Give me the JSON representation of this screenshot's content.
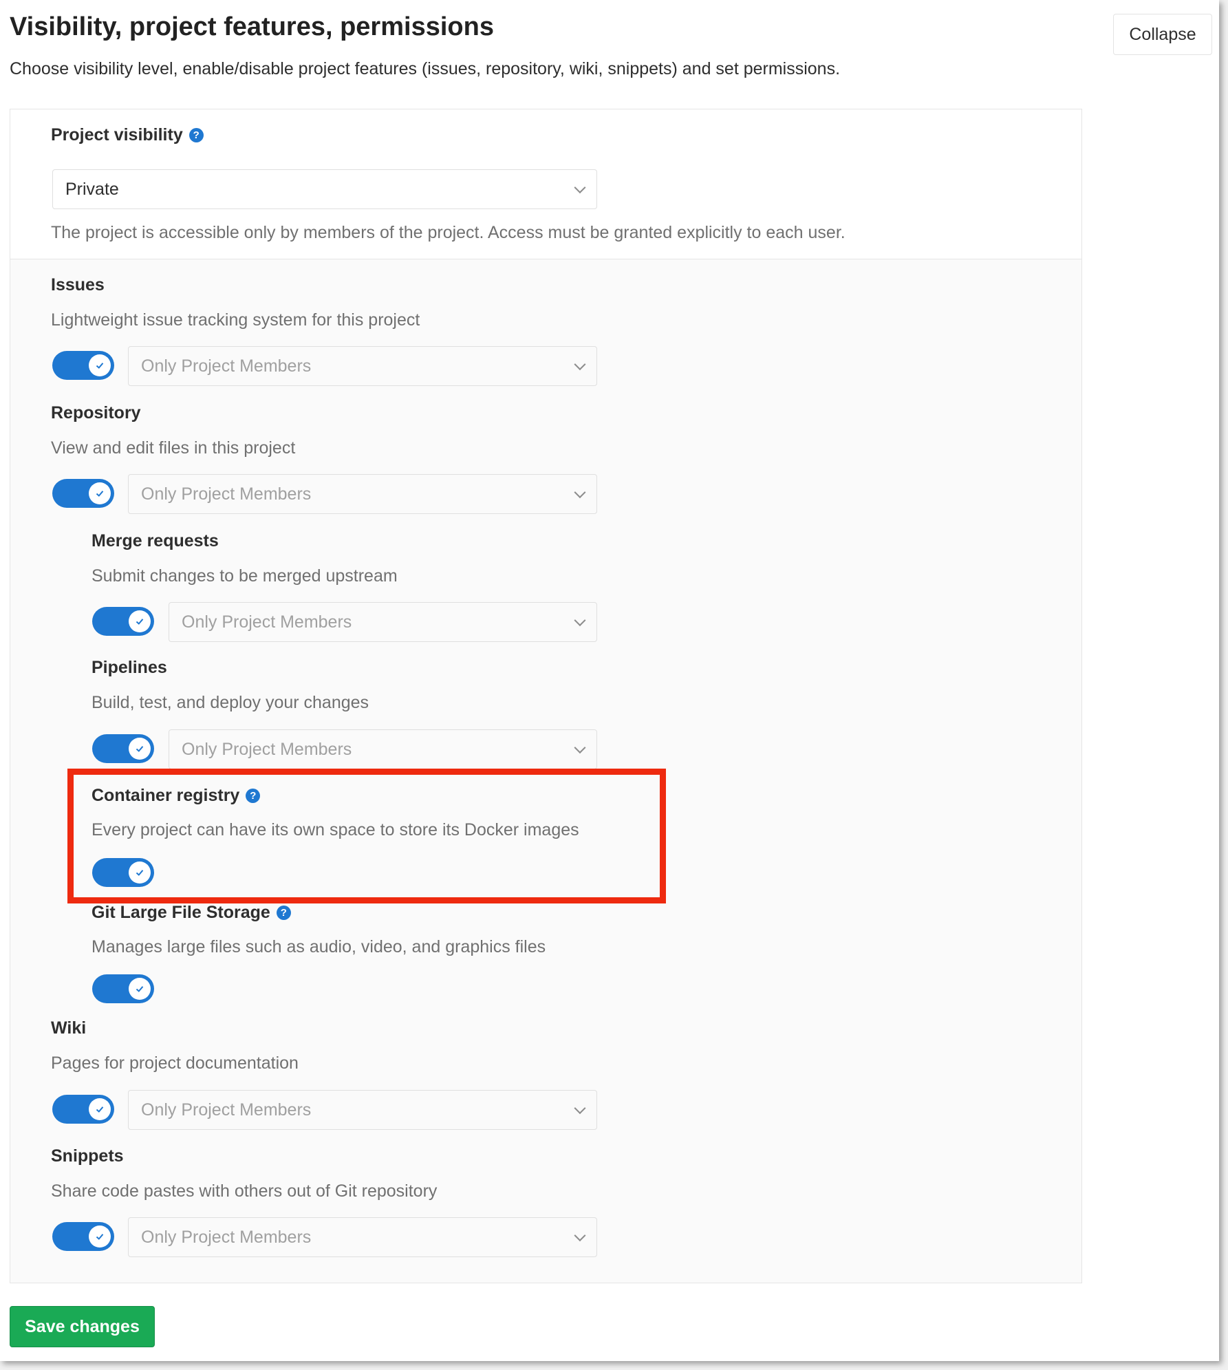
{
  "header": {
    "title": "Visibility, project features, permissions",
    "subtitle": "Choose visibility level, enable/disable project features (issues, repository, wiki, snippets) and set permissions.",
    "collapse_label": "Collapse"
  },
  "visibility": {
    "label": "Project visibility",
    "help_glyph": "?",
    "selected": "Private",
    "description": "The project is accessible only by members of the project. Access must be granted explicitly to each user."
  },
  "features": {
    "issues": {
      "label": "Issues",
      "description": "Lightweight issue tracking system for this project",
      "access": "Only Project Members",
      "enabled": true
    },
    "repository": {
      "label": "Repository",
      "description": "View and edit files in this project",
      "access": "Only Project Members",
      "enabled": true
    },
    "merge_requests": {
      "label": "Merge requests",
      "description": "Submit changes to be merged upstream",
      "access": "Only Project Members",
      "enabled": true
    },
    "pipelines": {
      "label": "Pipelines",
      "description": "Build, test, and deploy your changes",
      "access": "Only Project Members",
      "enabled": true
    },
    "container_registry": {
      "label": "Container registry",
      "help_glyph": "?",
      "description": "Every project can have its own space to store its Docker images",
      "enabled": true
    },
    "git_lfs": {
      "label": "Git Large File Storage",
      "help_glyph": "?",
      "description": "Manages large files such as audio, video, and graphics files",
      "enabled": true
    },
    "wiki": {
      "label": "Wiki",
      "description": "Pages for project documentation",
      "access": "Only Project Members",
      "enabled": true
    },
    "snippets": {
      "label": "Snippets",
      "description": "Share code pastes with others out of Git repository",
      "access": "Only Project Members",
      "enabled": true
    }
  },
  "footer": {
    "save_label": "Save changes"
  },
  "colors": {
    "accent_blue": "#1f78d1",
    "save_green": "#1aaa55",
    "highlight_red": "#ee2a0f"
  }
}
